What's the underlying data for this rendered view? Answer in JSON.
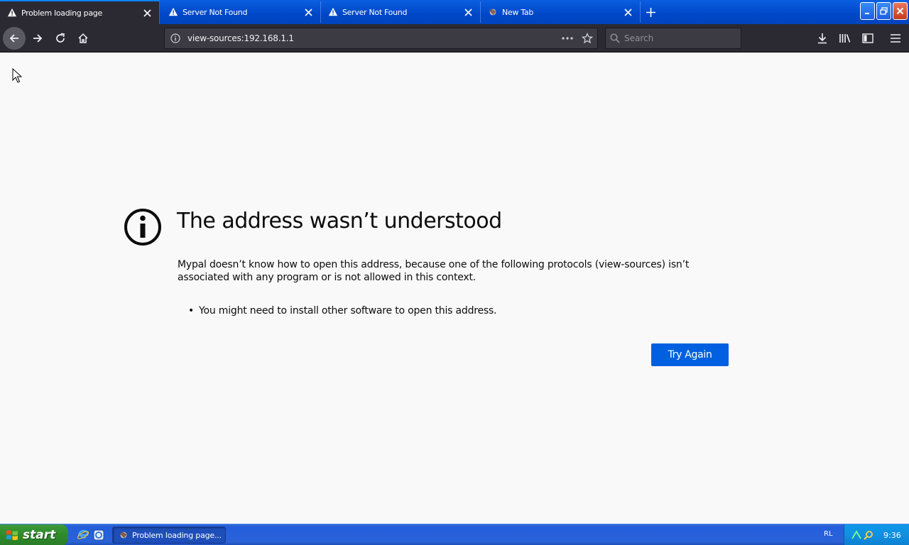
{
  "tabs": [
    {
      "label": "Problem loading page",
      "icon": "warning-icon",
      "active": true
    },
    {
      "label": "Server Not Found",
      "icon": "warning-icon",
      "active": false
    },
    {
      "label": "Server Not Found",
      "icon": "warning-icon",
      "active": false
    },
    {
      "label": "New Tab",
      "icon": "browser-logo-icon",
      "active": false
    }
  ],
  "navbar": {
    "url": "view-sources:192.168.1.1",
    "search_placeholder": "Search"
  },
  "error": {
    "title": "The address wasn’t understood",
    "description": "Mypal doesn’t know how to open this address, because one of the following protocols (view-sources) isn’t associated with any program or is not allowed in this context.",
    "bullets": [
      "You might need to install other software to open this address."
    ],
    "button_label": "Try Again"
  },
  "taskbar": {
    "start_label": "start",
    "task_label": "Problem loading page...",
    "lang": "RL",
    "clock": "9:36"
  },
  "colors": {
    "accent": "#0060df",
    "toolbar": "#2b2a33",
    "page_bg": "#f9f9fa",
    "xp_blue": "#245edc",
    "xp_start_green": "#2f8a2c"
  }
}
